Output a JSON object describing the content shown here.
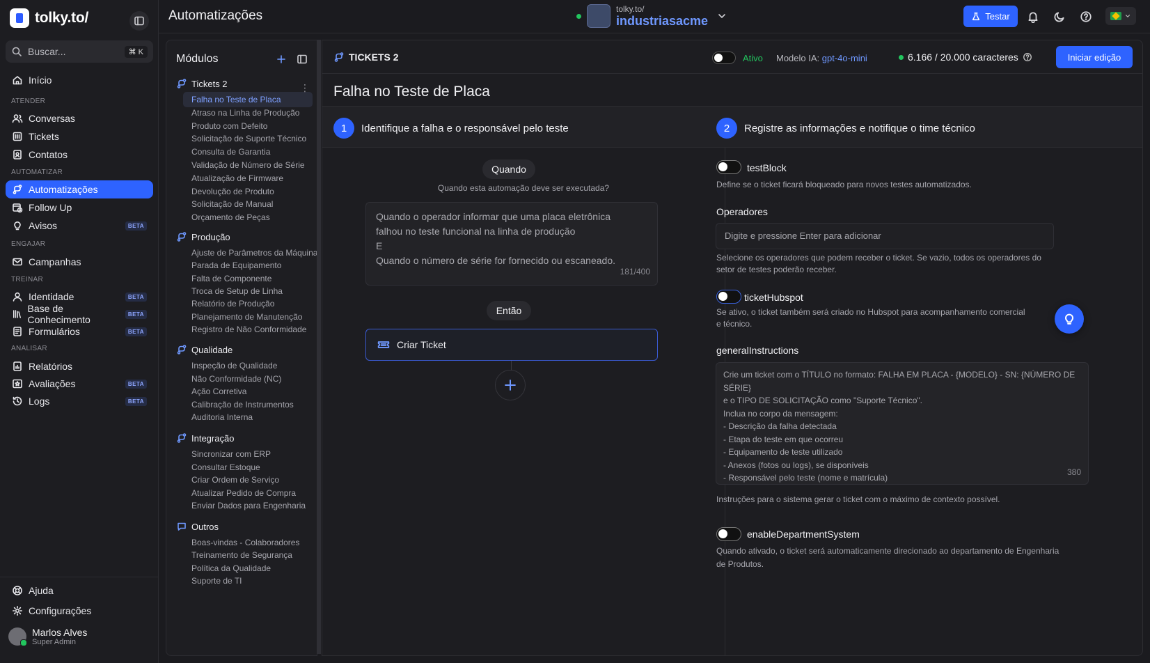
{
  "app": {
    "logo_text": "tolky.to/",
    "page_title": "Automatizações"
  },
  "search": {
    "placeholder": "Buscar...",
    "shortcut": "⌘ K"
  },
  "sidebar": {
    "home": "Início",
    "sections": {
      "atender": "ATENDER",
      "automatizar": "AUTOMATIZAR",
      "engajar": "ENGAJAR",
      "treinar": "TREINAR",
      "analisar": "ANALISAR"
    },
    "items": {
      "conversas": "Conversas",
      "tickets": "Tickets",
      "contatos": "Contatos",
      "automatizacoes": "Automatizações",
      "followup": "Follow Up",
      "avisos": "Avisos",
      "campanhas": "Campanhas",
      "identidade": "Identidade",
      "base": "Base de Conhecimento",
      "formularios": "Formulários",
      "relatorios": "Relatórios",
      "avaliacoes": "Avaliações",
      "logs": "Logs"
    },
    "badge": "BETA",
    "help": "Ajuda",
    "settings": "Configurações",
    "user": {
      "name": "Marlos Alves",
      "role": "Super Admin"
    }
  },
  "topbar": {
    "org_prefix": "tolky.to/",
    "org_name": "industriasacme",
    "test_button": "Testar"
  },
  "modules": {
    "title": "Módulos",
    "groups": [
      {
        "name": "Tickets 2",
        "items": [
          "Falha no Teste de Placa",
          "Atraso na Linha de Produção",
          "Produto com Defeito",
          "Solicitação de Suporte Técnico",
          "Consulta de Garantia",
          "Validação de Número de Série",
          "Atualização de Firmware",
          "Devolução de Produto",
          "Solicitação de Manual",
          "Orçamento de Peças"
        ]
      },
      {
        "name": "Produção",
        "items": [
          "Ajuste de Parâmetros da Máquina",
          "Parada de Equipamento",
          "Falta de Componente",
          "Troca de Setup de Linha",
          "Relatório de Produção",
          "Planejamento de Manutenção",
          "Registro de Não Conformidade"
        ]
      },
      {
        "name": "Qualidade",
        "items": [
          "Inspeção de Qualidade",
          "Não Conformidade (NC)",
          "Ação Corretiva",
          "Calibração de Instrumentos",
          "Auditoria Interna"
        ]
      },
      {
        "name": "Integração",
        "items": [
          "Sincronizar com ERP",
          "Consultar Estoque",
          "Criar Ordem de Serviço",
          "Atualizar Pedido de Compra",
          "Enviar Dados para Engenharia"
        ]
      },
      {
        "name": "Outros",
        "items": [
          "Boas-vindas - Colaboradores",
          "Treinamento de Segurança",
          "Política da Qualidade",
          "Suporte de TI"
        ]
      }
    ]
  },
  "workflow": {
    "name": "TICKETS 2",
    "active_label": "Ativo",
    "model_label": "Modelo IA:",
    "model_value": "gpt-4o-mini",
    "chars": "6.166 / 20.000 caracteres",
    "edit_button": "Iniciar edição",
    "automation_title": "Falha no Teste de Placa",
    "step1": {
      "num": "1",
      "label": "Identifique a falha e o responsável pelo teste"
    },
    "step2": {
      "num": "2",
      "label": "Registre as informações e notifique o time técnico"
    },
    "when_label": "Quando",
    "when_hint": "Quando esta automação deve ser executada?",
    "when_lines": [
      "Quando o operador informar que uma placa eletrônica",
      "falhou no teste funcional na linha de produção",
      "E",
      "Quando o número de série for fornecido ou escaneado."
    ],
    "when_count": "181/400",
    "then_label": "Então",
    "action_label": "Criar Ticket"
  },
  "form": {
    "testblock": {
      "label": "testBlock",
      "desc": "Define se o ticket ficará bloqueado para novos testes automatizados."
    },
    "operators": {
      "label": "Operadores",
      "placeholder": "Digite e pressione Enter para adicionar",
      "desc1": "Selecione os operadores que podem receber o ticket. Se vazio, todos os operadores do",
      "desc2": "setor de testes poderão receber."
    },
    "hubspot": {
      "label": "ticketHubspot",
      "desc1": "Se ativo, o ticket também será criado no Hubspot para acompanhamento comercial",
      "desc2": "e técnico."
    },
    "instructions": {
      "label": "generalInstructions",
      "lines": [
        "Crie um ticket com o TÍTULO no formato: FALHA EM PLACA - {MODELO} - SN: {NÚMERO DE SÉRIE}",
        "e o TIPO DE SOLICITAÇÃO como \"Suporte Técnico\".",
        "Inclua no corpo da mensagem:",
        "- Descrição da falha detectada",
        "- Etapa do teste em que ocorreu",
        "- Equipamento de teste utilizado",
        "- Anexos (fotos ou logs), se disponíveis",
        "- Responsável pelo teste (nome e matrícula)"
      ],
      "count": "380",
      "desc": "Instruções para o sistema gerar o ticket com o máximo de contexto possível."
    },
    "department": {
      "label": "enableDepartmentSystem",
      "desc1": "Quando ativado, o ticket será automaticamente direcionado ao departamento de Engenharia",
      "desc2": "de Produtos."
    }
  },
  "colors": {
    "accent": "#2e63ff",
    "link": "#6f98ff",
    "success": "#22c55e",
    "background": "#1b1b1f"
  }
}
